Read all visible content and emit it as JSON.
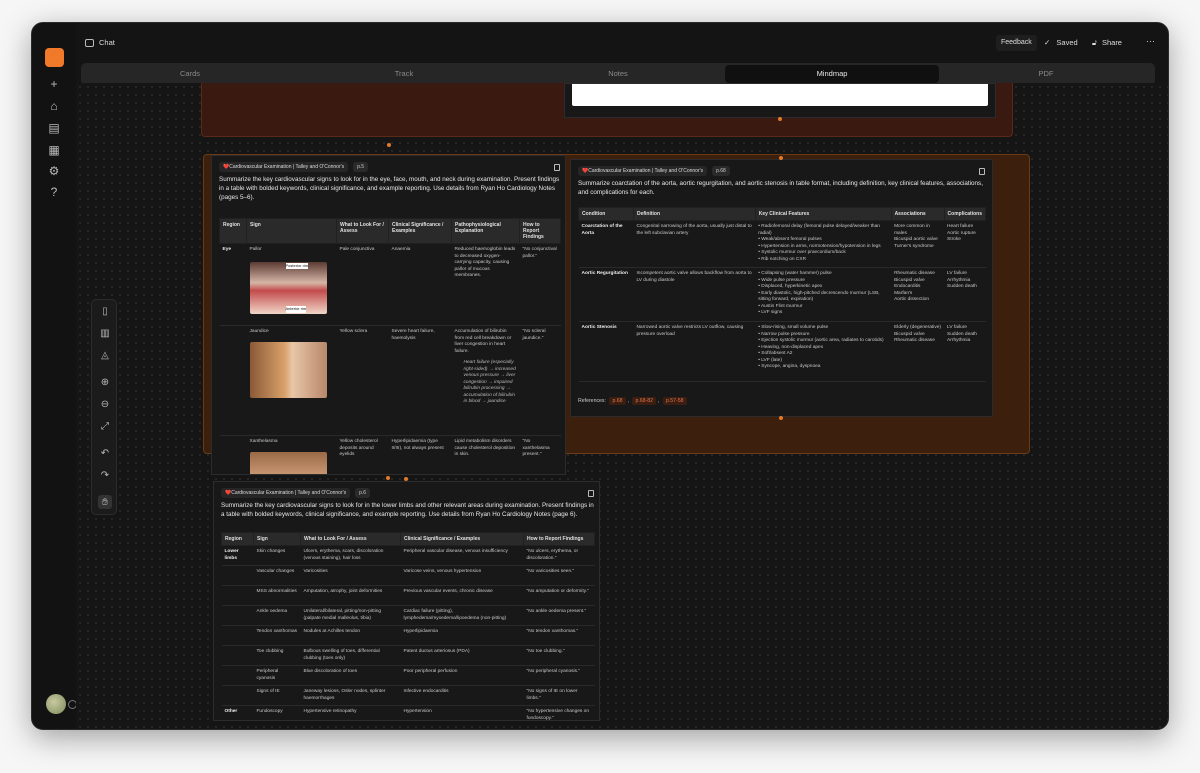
{
  "topbar": {
    "chat_label": "Chat",
    "feedback": "Feedback",
    "saved": "Saved",
    "share": "Share"
  },
  "tabs": [
    "Cards",
    "Track",
    "Notes",
    "Mindmap",
    "PDF"
  ],
  "card1": {
    "title": "❤️Cardiovascular Examination | Talley and O'Connor's",
    "page": "p.5",
    "prompt": "Summarize the key cardiovascular signs to look for in the eye, face, mouth, and neck during examination. Present findings in a table with bolded keywords, clinical significance, and example reporting. Use details from Ryan Ho Cardiology Notes (pages 5–6).",
    "headers": [
      "Region",
      "Sign",
      "What to Look For / Assess",
      "Clinical Significance / Examples",
      "Pathophysiological Explanation",
      "How to Report Findings"
    ],
    "rows": [
      [
        "Eye",
        "Pallor",
        "Pale conjunctiva",
        "Anaemia",
        "Reduced haemoglobin leads to decreased oxygen-carrying capacity, causing pallor of mucous membranes.",
        "\"No conjunctival pallor.\""
      ],
      [
        "",
        "Jaundice",
        "Yellow sclera",
        "Severe heart failure, haemolysis",
        "Accumulation of bilirubin from red cell breakdown or liver congestion in heart failure.",
        "\"No scleral jaundice.\""
      ],
      [
        "",
        "Xanthelasma",
        "Yellow cholesterol deposits around eyelids",
        "Hyperlipidaemia (type II/III), not always present",
        "Lipid metabolism disorders cause cholesterol deposition in skin.",
        "\"No xanthelasma present.\""
      ]
    ],
    "jaundice_note": "Heart failure (especially right-sided) → increased venous pressure → liver congestion → impaired bilirubin processing → accumulation of bilirubin in blood → jaundice",
    "img_label_top": "Posterior rim",
    "img_label_bottom": "Anterior rim"
  },
  "card2": {
    "title": "❤️Cardiovascular Examination | Talley and O'Connor's",
    "page": "p.68",
    "prompt": "Summarize coarctation of the aorta, aortic regurgitation, and aortic stenosis in table format, including definition, key clinical features, associations, and complications for each.",
    "headers": [
      "Condition",
      "Definition",
      "Key Clinical Features",
      "Associations",
      "Complications"
    ],
    "rows": [
      [
        "Coarctation of the Aorta",
        "Congenital narrowing of the aorta, usually just distal to the left subclavian artery",
        "• Radiofemoral delay (femoral pulse delayed/weaker than radial)\n• Weak/absent femoral pulses\n• Hypertension in arms, normotension/hypotension in legs\n• Systolic murmur over praecordium/back\n• Rib notching on CXR",
        "More common in males\nBicuspid aortic valve\nTurner's syndrome",
        "Heart failure\nAortic rupture\nStroke"
      ],
      [
        "Aortic Regurgitation",
        "Incompetent aortic valve allows backflow from aorta to LV during diastole",
        "• Collapsing (water hammer) pulse\n• Wide pulse pressure\n• Displaced, hyperkinetic apex\n• Early diastolic, high-pitched decrescendo murmur (LSB, sitting forward, expiration)\n• Austin Flint murmur\n• LVF signs",
        "Rheumatic disease\nBicuspid valve\nEndocarditis\nMarfan's\nAortic dissection",
        "LV failure\nArrhythmia\nSudden death"
      ],
      [
        "Aortic Stenosis",
        "Narrowed aortic valve restricts LV outflow, causing pressure overload",
        "• Slow-rising, small volume pulse\n• Narrow pulse pressure\n• Ejection systolic murmur (aortic area, radiates to carotids)\n• Heaving, non-displaced apex\n• Soft/absent A2\n• LVF (late)\n• Syncope, angina, dyspnoea",
        "Elderly (degenerative)\nBicuspid valve\nRheumatic disease",
        "LV failure\nSudden death\nArrhythmia"
      ]
    ],
    "refs_label": "References:",
    "refs": [
      "p.68",
      "p.68-82",
      "p.57-58"
    ]
  },
  "card3": {
    "title": "❤️Cardiovascular Examination | Talley and O'Connor's",
    "page": "p.6",
    "prompt": "Summarize the key cardiovascular signs to look for in the lower limbs and other relevant areas during examination. Present findings in a table with bolded keywords, clinical significance, and example reporting. Use details from Ryan Ho Cardiology Notes (page 6).",
    "headers": [
      "Region",
      "Sign",
      "What to Look For / Assess",
      "Clinical Significance / Examples",
      "How to Report Findings"
    ],
    "rows": [
      [
        "Lower limbs",
        "Skin changes",
        "Ulcers, erythema, scars, discoloration (venous staining), hair loss",
        "Peripheral vascular disease, venous insufficiency",
        "\"No ulcers, erythema, or discoloration.\""
      ],
      [
        "",
        "Vascular changes",
        "Varicosities",
        "Varicose veins, venous hypertension",
        "\"No varicosities seen.\""
      ],
      [
        "",
        "MSS abnormalities",
        "Amputation, atrophy, joint deformities",
        "Previous vascular events, chronic disease",
        "\"No amputation or deformity.\""
      ],
      [
        "",
        "Ankle oedema",
        "Unilateral/bilateral, pitting/non-pitting (palpate medial malleolus, tibia)",
        "Cardiac failure (pitting), lymphedema/myxedema/lipoedema (non-pitting)",
        "\"No ankle oedema present.\""
      ],
      [
        "",
        "Tendon xanthomas",
        "Nodules at Achilles tendon",
        "Hyperlipidaemia",
        "\"No tendon xanthomas.\""
      ],
      [
        "",
        "Toe clubbing",
        "Bulbous swelling of toes, differential clubbing (toes only)",
        "Patent ductus arteriosus (PDA)",
        "\"No toe clubbing.\""
      ],
      [
        "",
        "Peripheral cyanosis",
        "Blue discoloration of toes",
        "Poor peripheral perfusion",
        "\"No peripheral cyanosis.\""
      ],
      [
        "",
        "Signs of IE",
        "Janeway lesions, Osler nodes, splinter haemorrhages",
        "Infective endocarditis",
        "\"No signs of IE on lower limbs.\""
      ],
      [
        "Other",
        "Fundoscopy",
        "Hypertensive retinopathy",
        "Hypertension",
        "\"No hypertensive changes on fundoscopy.\""
      ]
    ]
  },
  "colors": {
    "accent": "#f07a2a",
    "canvas": "#151515",
    "card": "#181818"
  },
  "icons": [
    "sidebar-toggle-icon",
    "check-icon",
    "lock-icon",
    "more-icon",
    "plus-icon",
    "home-icon",
    "notes-icon",
    "grid-icon",
    "settings-icon",
    "help-icon",
    "page-icon",
    "book-icon",
    "shapes-icon",
    "zoom-in-icon",
    "zoom-out-icon",
    "fit-icon",
    "undo-icon",
    "redo-icon",
    "hand-icon",
    "trash-icon"
  ]
}
